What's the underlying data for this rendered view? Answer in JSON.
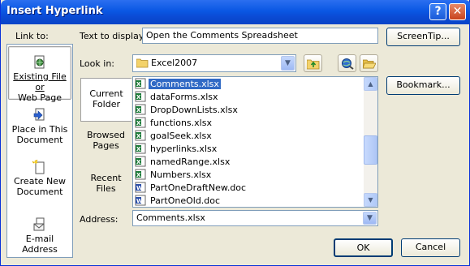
{
  "window": {
    "title": "Insert Hyperlink",
    "help_glyph": "?",
    "close_glyph": "✕"
  },
  "link_to": {
    "label": "Link to:",
    "items": [
      {
        "label_line1": "Existing File or",
        "label_line2": "Web Page",
        "icon": "globe-document-icon"
      },
      {
        "label_line1": "Place in This",
        "label_line2": "Document",
        "icon": "document-place-icon"
      },
      {
        "label_line1": "Create New",
        "label_line2": "Document",
        "icon": "new-document-icon"
      },
      {
        "label_line1": "E-mail Address",
        "label_line2": "",
        "icon": "envelope-icon"
      }
    ]
  },
  "text_to_display": {
    "label": "Text to display:",
    "value": "Open the Comments Spreadsheet"
  },
  "screentip_button": "ScreenTip...",
  "look_in": {
    "label": "Look in:",
    "value": "Excel2007",
    "icon": "folder-icon"
  },
  "tabs": [
    {
      "line1": "Current",
      "line2": "Folder"
    },
    {
      "line1": "Browsed",
      "line2": "Pages"
    },
    {
      "line1": "Recent",
      "line2": "Files"
    }
  ],
  "files": [
    {
      "name": "Comments.xlsx",
      "type": "excel",
      "selected": true
    },
    {
      "name": "dataForms.xlsx",
      "type": "excel",
      "selected": false
    },
    {
      "name": "DropDownLists.xlsx",
      "type": "excel",
      "selected": false
    },
    {
      "name": "functions.xlsx",
      "type": "excel",
      "selected": false
    },
    {
      "name": "goalSeek.xlsx",
      "type": "excel",
      "selected": false
    },
    {
      "name": "hyperlinks.xlsx",
      "type": "excel",
      "selected": false
    },
    {
      "name": "namedRange.xlsx",
      "type": "excel",
      "selected": false
    },
    {
      "name": "Numbers.xlsx",
      "type": "excel",
      "selected": false
    },
    {
      "name": "PartOneDraftNew.doc",
      "type": "word",
      "selected": false
    },
    {
      "name": "PartOneOld.doc",
      "type": "word",
      "selected": false
    }
  ],
  "bookmark_button": "Bookmark...",
  "address": {
    "label": "Address:",
    "value": "Comments.xlsx"
  },
  "ok_button": "OK",
  "cancel_button": "Cancel",
  "colors": {
    "title_blue": "#0a57e3",
    "selection_blue": "#316ac5",
    "excel_green": "#1d7b3a",
    "word_blue": "#2b4fa8"
  }
}
